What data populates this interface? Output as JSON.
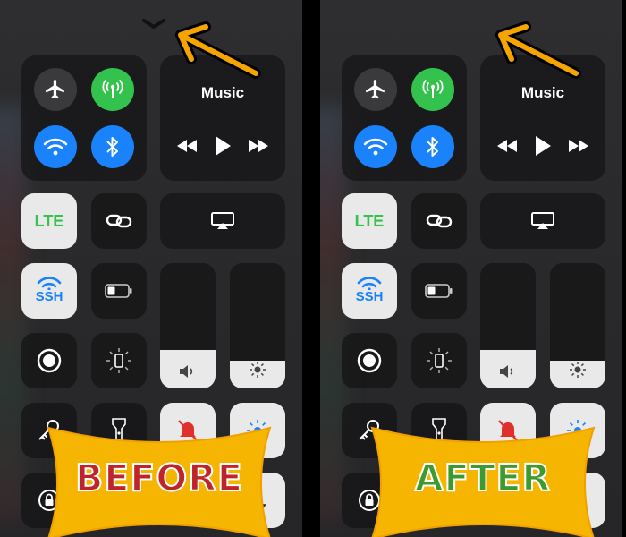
{
  "music": {
    "title": "Music"
  },
  "tiles": {
    "lte_label": "LTE",
    "ssh_label": "SSH"
  },
  "labels": {
    "before": "BEFORE",
    "after": "AFTER"
  },
  "colors": {
    "green": "#33c24d",
    "blue": "#1a82fb",
    "arrow": "#f5a400",
    "banner": "#f6b500",
    "before_text": "#c0242b",
    "after_text": "#3c9a2e",
    "lte": "#33c24d",
    "ssh": "#1a82fb"
  },
  "sliders": {
    "volume_level": 0.31,
    "brightness_level": 0.22
  },
  "icons": [
    "chevron-down-icon",
    "airplane-icon",
    "cellular-icon",
    "wifi-icon",
    "bluetooth-icon",
    "rewind-icon",
    "play-icon",
    "forward-icon",
    "lte-icon",
    "link-icon",
    "airplay-icon",
    "ssh-wifi-icon",
    "battery-icon",
    "volume-icon",
    "brightness-icon",
    "record-icon",
    "orientation-icon",
    "key-icon",
    "flashlight-icon",
    "mute-bell-icon",
    "night-shift-icon",
    "lock-icon",
    "moon-icon",
    "arrow-icon"
  ]
}
